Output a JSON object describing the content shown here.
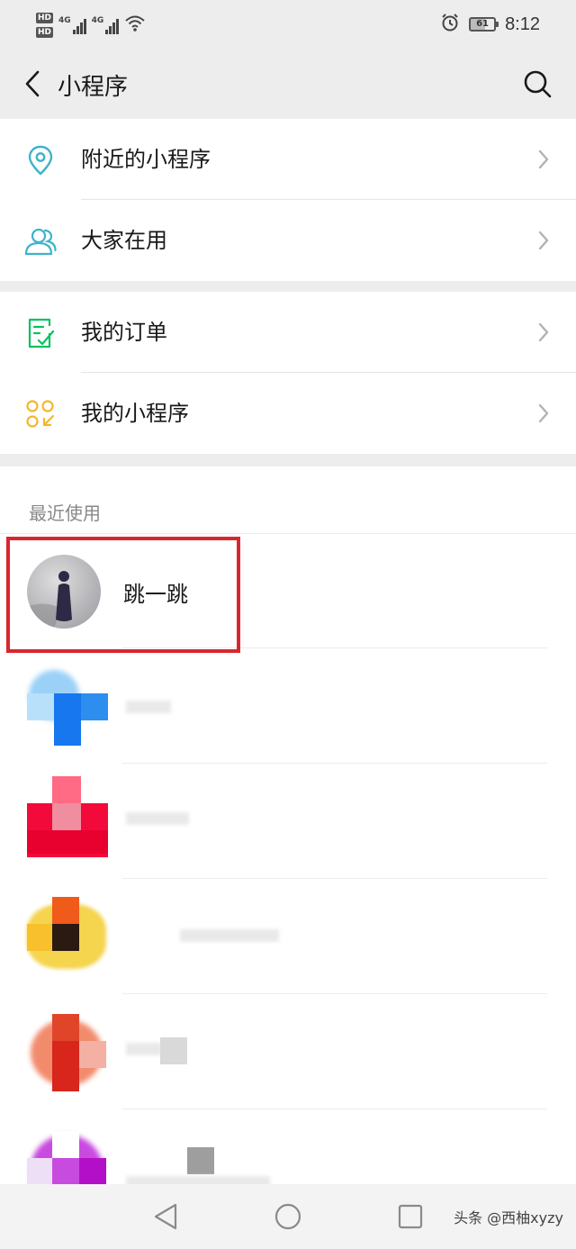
{
  "status_bar": {
    "hd1": "HD",
    "hd2": "HD",
    "signal1_label": "4G",
    "signal2_label": "4G",
    "battery_level": "61",
    "time": "8:12",
    "icons": [
      "alarm-icon",
      "wifi-icon",
      "battery-icon"
    ]
  },
  "nav": {
    "title": "小程序",
    "icons": [
      "back-arrow-icon",
      "search-icon"
    ]
  },
  "menu_group_1": [
    {
      "label": "附近的小程序",
      "icon": "location-pin-icon"
    },
    {
      "label": "大家在用",
      "icon": "people-icon"
    }
  ],
  "menu_group_2": [
    {
      "label": "我的订单",
      "icon": "order-checklist-icon"
    },
    {
      "label": "我的小程序",
      "icon": "mini-program-grid-icon"
    }
  ],
  "recent": {
    "header": "最近使用",
    "items": [
      {
        "name": "跳一跳",
        "highlighted": true
      }
    ]
  },
  "watermark": "头条 @西柚xyzy",
  "colors": {
    "background": "#ededed",
    "card": "#ffffff",
    "accent_green": "#07c160",
    "accent_teal": "#3fb2c9",
    "accent_yellow": "#f2b829",
    "highlight_red": "#d9272e"
  }
}
